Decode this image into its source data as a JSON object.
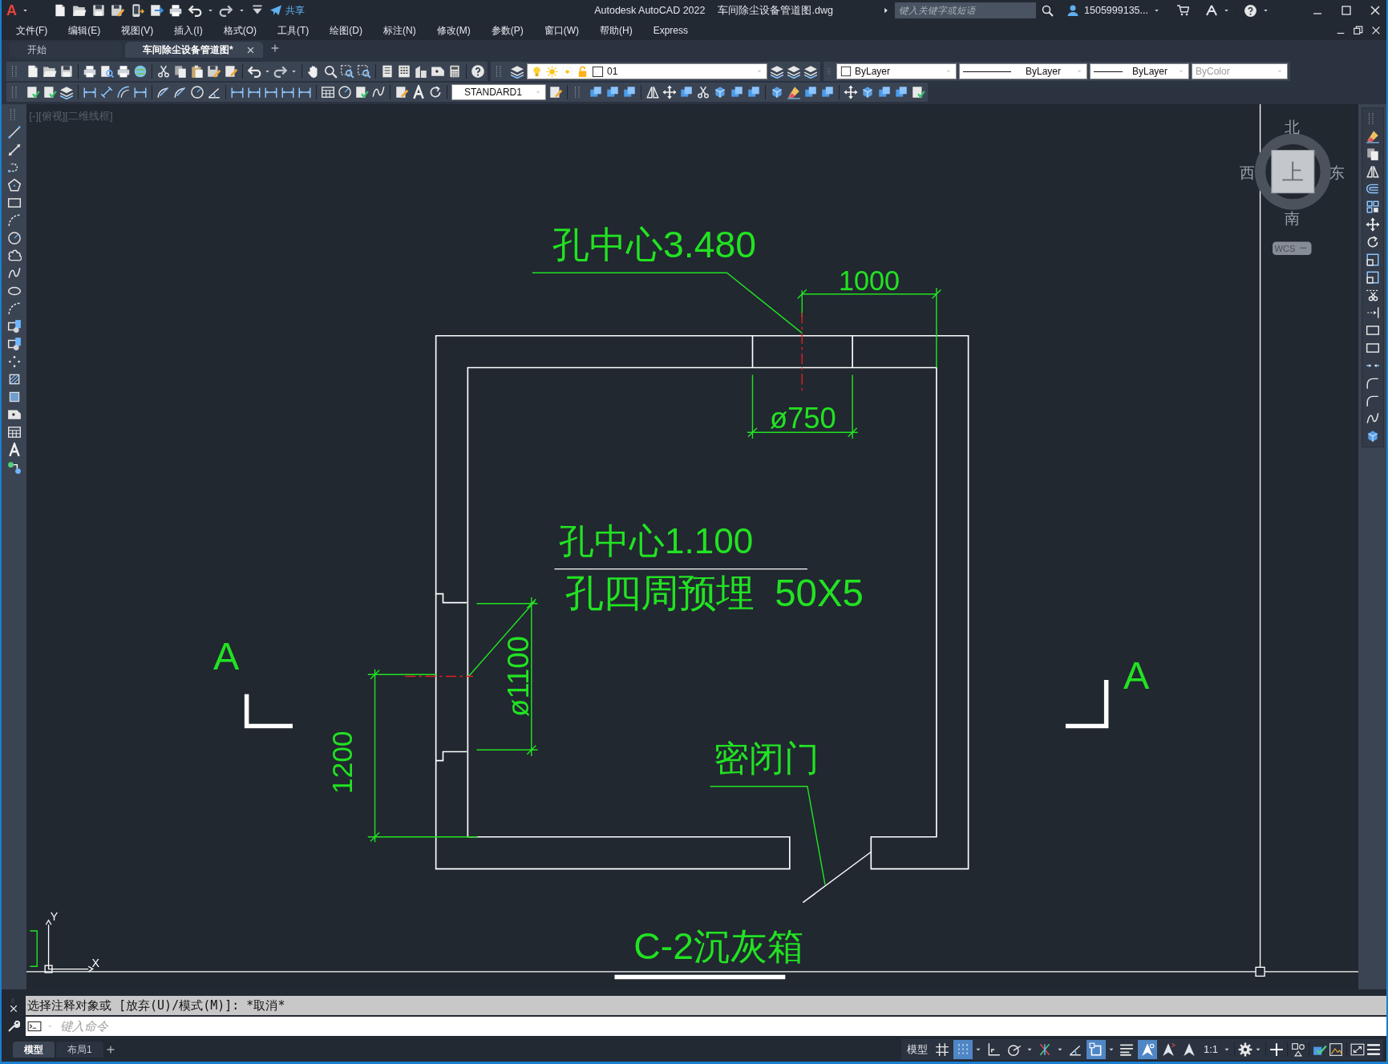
{
  "title_bar": {
    "logo": "A",
    "share": "共享",
    "app_title": "Autodesk AutoCAD 2022",
    "file_name": "车间除尘设备管道图.dwg",
    "search": {
      "placeholder": "键入关键字或短语"
    },
    "user": "1505999135..."
  },
  "menu": [
    "文件(F)",
    "编辑(E)",
    "视图(V)",
    "插入(I)",
    "格式(O)",
    "工具(T)",
    "绘图(D)",
    "标注(N)",
    "修改(M)",
    "参数(P)",
    "窗口(W)",
    "帮助(H)",
    "Express"
  ],
  "file_tabs": [
    {
      "label": "开始",
      "selected": false
    },
    {
      "label": "车间除尘设备管道图*",
      "selected": true
    }
  ],
  "properties": {
    "layer": "01",
    "color_control": "ByLayer",
    "linetype": "ByLayer",
    "lineweight": "ByLayer",
    "plot_style": "ByColor",
    "plot_style_disabled": true,
    "text_style": "STANDARD1"
  },
  "viewport": {
    "label": "[-][俯视][二维线框]",
    "annotations": [
      "孔中心3.480",
      "1000",
      "ø750",
      "孔中心1.100",
      "孔四周预埋  50X5",
      "A",
      "A",
      "ø1100",
      "1200",
      "密闭门",
      "C-2沉灰箱"
    ],
    "ucs": {
      "y": "Y",
      "x": "X"
    },
    "viewcube": {
      "north": "北",
      "west": "西",
      "top": "上",
      "east": "东",
      "south": "南",
      "ucs_menu": "WCS"
    }
  },
  "command_line": {
    "history": "选择注释对象或 [放弃(U)/模式(M)]: *取消*",
    "placeholder": "键入命令"
  },
  "layout_tabs": [
    {
      "label": "模型",
      "selected": true
    },
    {
      "label": "布局1",
      "selected": false
    }
  ],
  "status_bar": {
    "space": "模型",
    "toggles": [
      {
        "kind": "grid",
        "on": false
      },
      {
        "kind": "snap",
        "on": true
      },
      {
        "kind": "ortho",
        "on": false
      },
      {
        "kind": "polar",
        "on": false
      },
      {
        "kind": "isodraft",
        "on": false
      },
      {
        "kind": "osnap_tracking",
        "on": false
      },
      {
        "kind": "osnap",
        "on": true
      },
      {
        "kind": "lineweight",
        "on": false
      },
      {
        "kind": "annotation_visibility",
        "on": true
      },
      {
        "kind": "auto_scale",
        "on": false
      },
      {
        "kind": "annotation_scale",
        "on": false
      }
    ],
    "scale": "1:1"
  }
}
